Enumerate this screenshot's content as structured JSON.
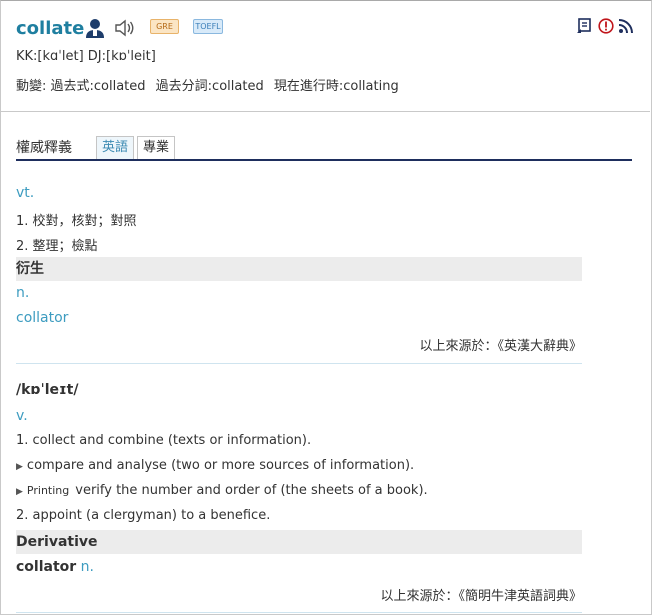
{
  "entry": {
    "word": "collate",
    "tags": [
      "GRE",
      "TOEFL"
    ],
    "pronunciation": "KK:[kɑˈlet] DJ:[kɒˈleit]",
    "forms": [
      "動變: 過去式:collated",
      "過去分詞:collated",
      "現在進行時:collating"
    ]
  },
  "tabs": {
    "title": "權威釋義",
    "items": [
      "英語",
      "專業"
    ]
  },
  "dict1": {
    "pos": "vt.",
    "senses": [
      "1. 校對，核對；對照",
      "2. 整理；檢點"
    ],
    "derivative_heading": "衍生",
    "derivative_pos": "n.",
    "derivative_word": "collator",
    "source": "以上來源於：《英漢大辭典》"
  },
  "dict2": {
    "ipa": "/kɒˈleɪt/",
    "pos": "v.",
    "sense1": "1. collect and combine (texts or information).",
    "sub1": "compare and analyse (two or more sources of information).",
    "sub2_domain": "Printing",
    "sub2": "verify the number and order of (the sheets of a book).",
    "sense2": "2. appoint (a clergyman) to a benefice.",
    "derivative_heading": "Derivative",
    "derivative_word": "collator",
    "derivative_pos": "n.",
    "source": "以上來源於：《簡明牛津英語詞典》"
  },
  "colors": {
    "accent": "#1f7fa0",
    "link": "#3d9cc0",
    "rule_dark": "#1e2e5d"
  }
}
